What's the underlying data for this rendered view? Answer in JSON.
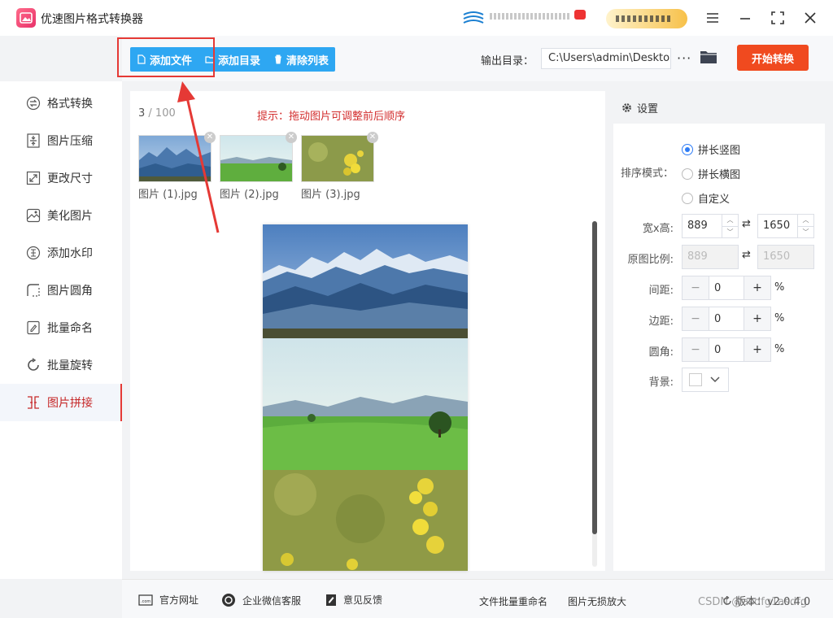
{
  "app": {
    "title": "优速图片格式转换器"
  },
  "toolbar": {
    "add_file": "添加文件",
    "add_folder": "添加目录",
    "clear_list": "清除列表",
    "output_label": "输出目录：",
    "output_path": "C:\\Users\\admin\\Deskto",
    "more": "···",
    "start": "开始转换"
  },
  "sidebar": {
    "items": [
      {
        "label": "格式转换",
        "icon": "convert-icon"
      },
      {
        "label": "图片压缩",
        "icon": "compress-icon"
      },
      {
        "label": "更改尺寸",
        "icon": "resize-icon"
      },
      {
        "label": "美化图片",
        "icon": "beautify-icon"
      },
      {
        "label": "添加水印",
        "icon": "watermark-icon"
      },
      {
        "label": "图片圆角",
        "icon": "round-corner-icon"
      },
      {
        "label": "批量命名",
        "icon": "rename-icon"
      },
      {
        "label": "批量旋转",
        "icon": "rotate-icon"
      },
      {
        "label": "图片拼接",
        "icon": "stitch-icon",
        "active": true
      }
    ]
  },
  "main": {
    "count_current": "3",
    "count_total": " / 100",
    "hint": "提示：拖动图片可调整前后顺序",
    "files": [
      {
        "name": "图片 (1).jpg"
      },
      {
        "name": "图片 (2).jpg"
      },
      {
        "name": "图片 (3).jpg"
      }
    ]
  },
  "settings": {
    "title": "设置",
    "sort_label": "排序模式：",
    "sort_options": [
      "拼长竖图",
      "拼长横图",
      "自定义"
    ],
    "size_label": "宽x高:",
    "width": "889",
    "height": "1650",
    "ratio_label": "原图比例:",
    "ratio_width": "889",
    "ratio_height": "1650",
    "spacing_label": "间距:",
    "spacing": "0",
    "margin_label": "边距:",
    "margin": "0",
    "corner_label": "圆角:",
    "corner": "0",
    "unit": "%",
    "bg_label": "背景:",
    "bg_color": "#ffffff"
  },
  "footer": {
    "website": "官方网址",
    "wechat": "企业微信客服",
    "feedback": "意见反馈",
    "rename_link": "文件批量重命名",
    "enlarge_link": "图片无损放大",
    "version": "版本：v2.0.4.0",
    "watermark": "CSDN @asdfg1asdfg"
  },
  "colors": {
    "accent": "#2ea7f2",
    "start": "#f04a1f",
    "active": "#c62828"
  }
}
